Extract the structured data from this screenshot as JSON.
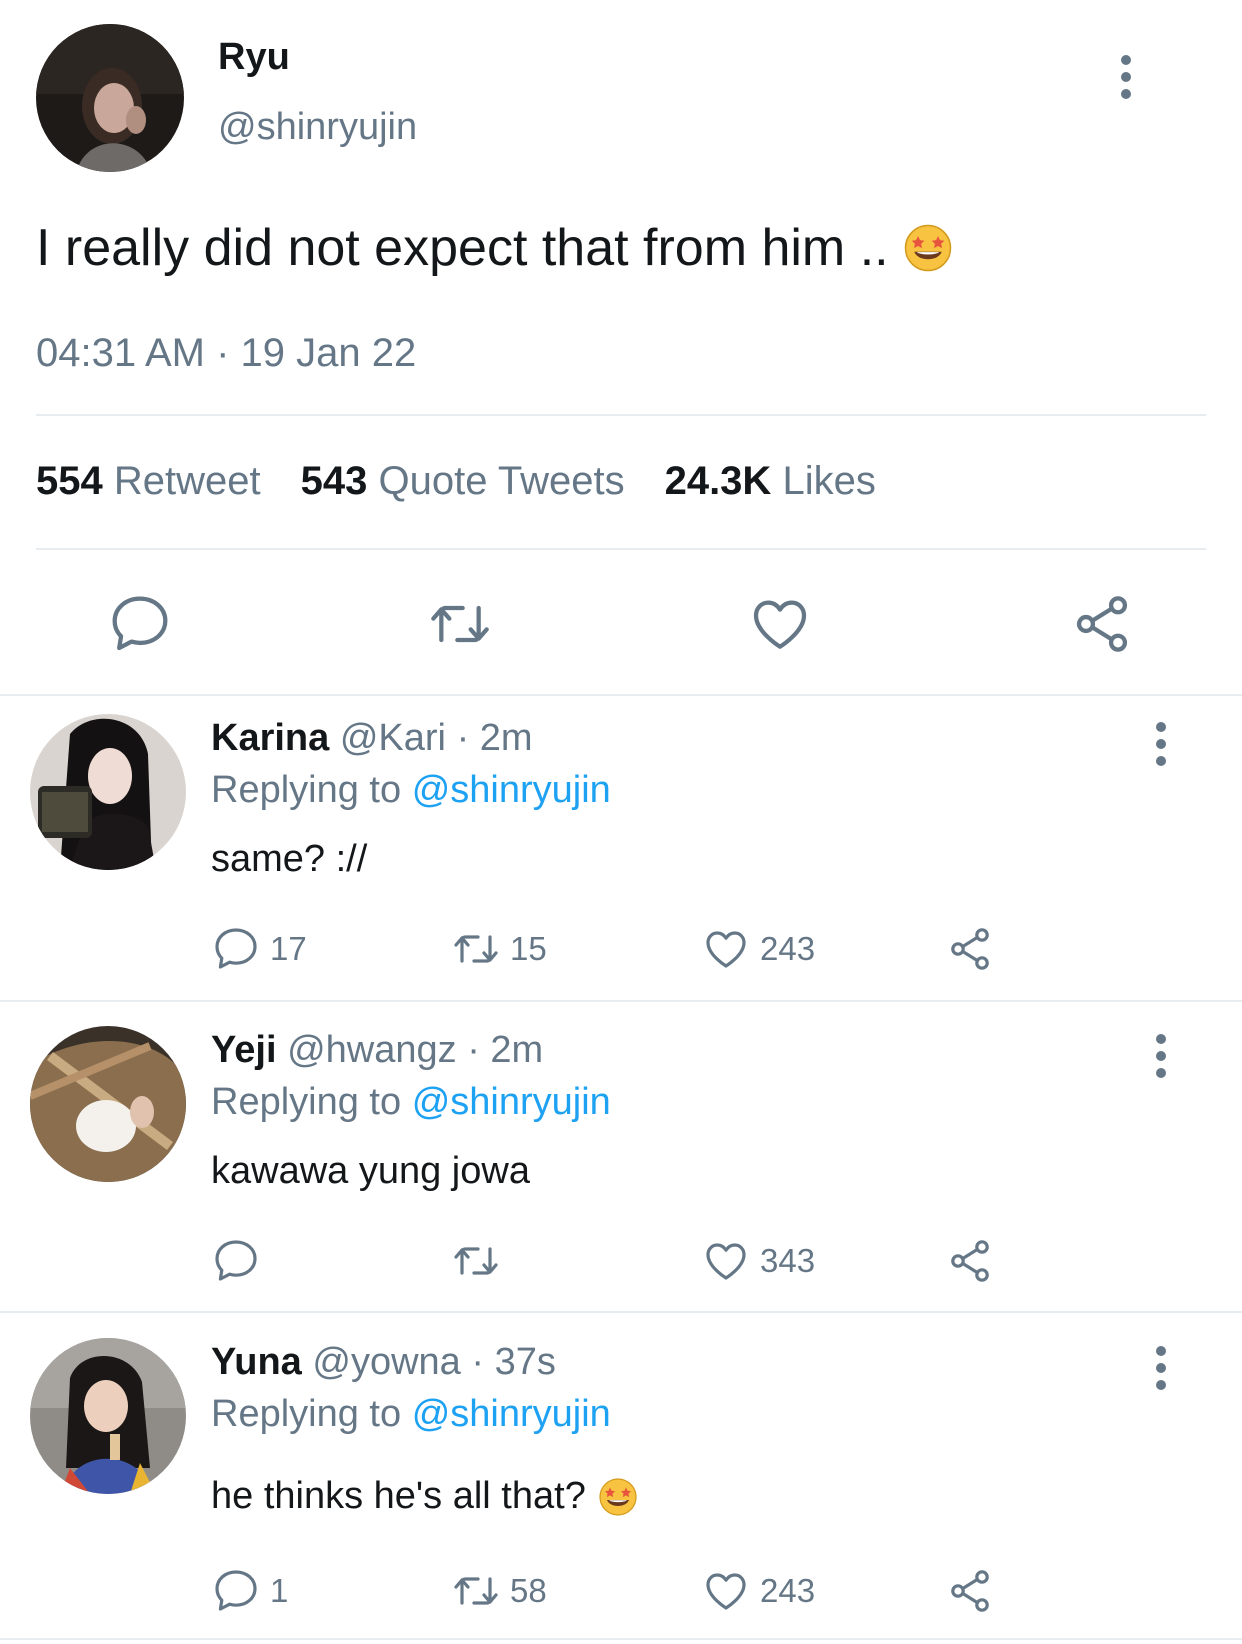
{
  "main_tweet": {
    "display_name": "Ryu",
    "handle": "@shinryujin",
    "text": "I really did not expect that from him ..",
    "emoji": "star-struck-emoji",
    "timestamp": "04:31 AM · 19 Jan 22",
    "stats": {
      "retweets_count": "554",
      "retweets_label": "Retweet",
      "quotes_count": "543",
      "quotes_label": "Quote Tweets",
      "likes_count": "24.3K",
      "likes_label": "Likes"
    },
    "actions": [
      "reply-icon",
      "retweet-icon",
      "like-icon",
      "share-icon"
    ]
  },
  "replies": [
    {
      "display_name": "Karina",
      "handle": "@Kari",
      "time": "· 2m",
      "replying_label": "Replying to",
      "replying_to": "@shinryujin",
      "text": "same? ://",
      "reply_count": "17",
      "retweet_count": "15",
      "like_count": "243"
    },
    {
      "display_name": "Yeji",
      "handle": "@hwangz",
      "time": "· 2m",
      "replying_label": "Replying to",
      "replying_to": "@shinryujin",
      "text": "kawawa yung jowa",
      "reply_count": "",
      "retweet_count": "",
      "like_count": "343"
    },
    {
      "display_name": "Yuna",
      "handle": "@yowna",
      "time": "· 37s",
      "replying_label": "Replying to",
      "replying_to": "@shinryujin",
      "text": "he thinks he's all that?",
      "emoji": "star-struck-emoji",
      "reply_count": "1",
      "retweet_count": "58",
      "like_count": "243"
    }
  ],
  "colors": {
    "text_primary": "#14171a",
    "text_secondary": "#657786",
    "link": "#1da1f2",
    "divider": "#e6ecf0"
  }
}
